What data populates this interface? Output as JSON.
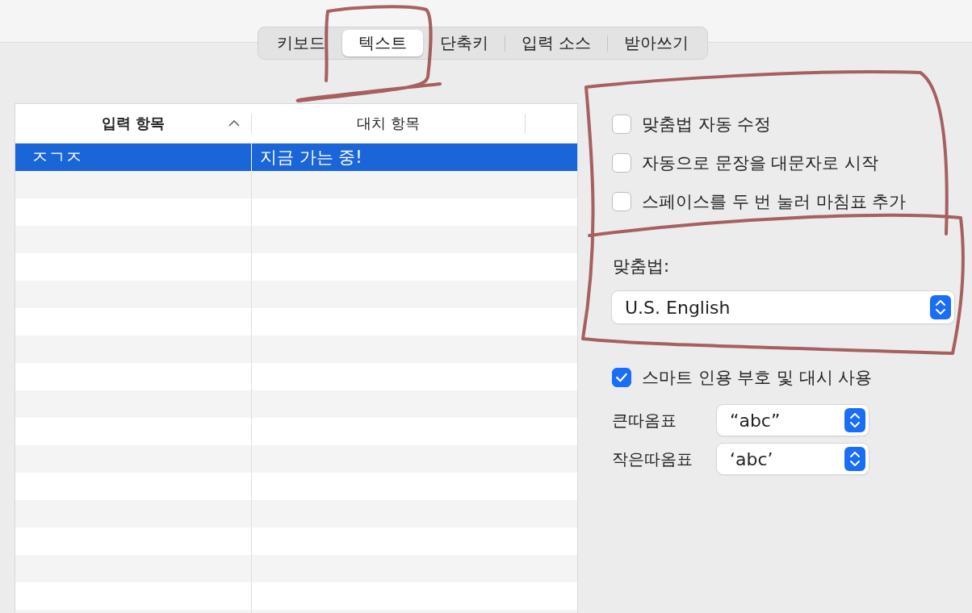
{
  "tabs": [
    {
      "label": "키보드",
      "selected": false
    },
    {
      "label": "텍스트",
      "selected": true
    },
    {
      "label": "단축키",
      "selected": false
    },
    {
      "label": "입력 소스",
      "selected": false
    },
    {
      "label": "받아쓰기",
      "selected": false
    }
  ],
  "table": {
    "columns": [
      {
        "label": "입력 항목",
        "sorted": true
      },
      {
        "label": "대치 항목",
        "sorted": false
      }
    ],
    "rows": [
      {
        "cells": [
          "ㅈㄱㅈ",
          "지금 가는 중!"
        ],
        "selected": true
      }
    ]
  },
  "options": [
    {
      "label": "맞춤법 자동 수정",
      "checked": false
    },
    {
      "label": "자동으로 문장을 대문자로 시작",
      "checked": false
    },
    {
      "label": "스페이스를 두 번 눌러 마침표 추가",
      "checked": false
    }
  ],
  "spelling": {
    "label": "맞춤법:",
    "value": "U.S. English"
  },
  "smart_quotes": {
    "label": "스마트 인용 부호 및 대시 사용",
    "checked": true
  },
  "quote_settings": [
    {
      "label": "큰따옴표",
      "value": "“abc”"
    },
    {
      "label": "작은따옴표",
      "value": "‘abc’"
    }
  ]
}
